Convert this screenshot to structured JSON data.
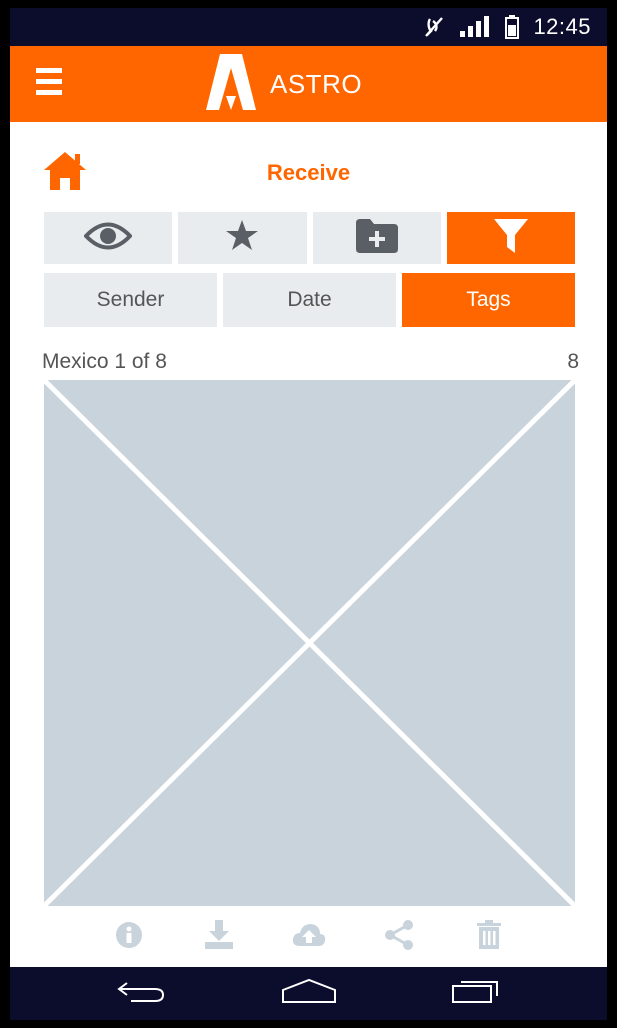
{
  "status_bar": {
    "time": "12:45",
    "icons": [
      "mute-icon",
      "signal-icon",
      "battery-icon"
    ]
  },
  "app_bar": {
    "title": "ASTRO",
    "icons": [
      "menu-icon",
      "astro-logo"
    ]
  },
  "page": {
    "title": "Receive"
  },
  "toolbar": {
    "buttons": [
      {
        "icon": "eye-icon",
        "active": false
      },
      {
        "icon": "star-icon",
        "active": false
      },
      {
        "icon": "add-folder-icon",
        "active": false
      },
      {
        "icon": "filter-icon",
        "active": true
      }
    ]
  },
  "sort_tabs": [
    {
      "label": "Sender",
      "active": false
    },
    {
      "label": "Date",
      "active": false
    },
    {
      "label": "Tags",
      "active": true
    }
  ],
  "viewer": {
    "position_label": "Mexico 1 of 8",
    "count": "8"
  },
  "actions": [
    "info-icon",
    "download-icon",
    "upload-cloud-icon",
    "share-icon",
    "trash-icon"
  ],
  "nav": [
    "back-icon",
    "home-icon",
    "recents-icon"
  ],
  "colors": {
    "accent": "#ff6600",
    "bar_bg": "#0c0c2c",
    "button_bg": "#e8ecef",
    "icon_gray": "#5a5f66",
    "placeholder": "#c8d3db"
  }
}
